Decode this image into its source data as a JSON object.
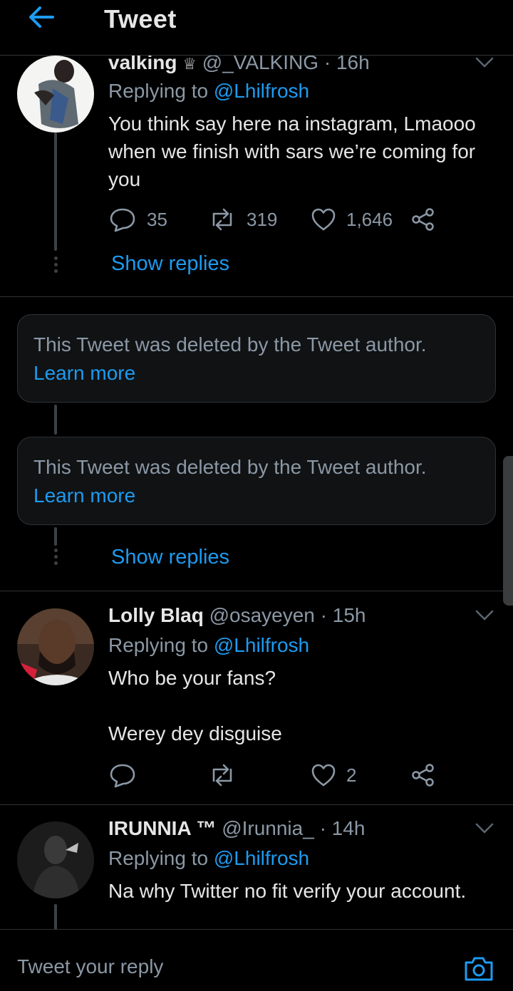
{
  "header": {
    "title": "Tweet"
  },
  "tweets": [
    {
      "name": "valking",
      "badge": "♕",
      "handle": "@_VALKING",
      "time": "· 16h",
      "replying_label": "Replying to",
      "replying_handle": "@Lhilfrosh",
      "text": "You think say here na instagram, Lmaooo when we finish with sars we’re coming for you",
      "replies": "35",
      "retweets": "319",
      "likes": "1,646"
    },
    {
      "name": "Lolly Blaq",
      "handle": "@osayeyen",
      "time": "· 15h",
      "replying_label": "Replying to",
      "replying_handle": "@Lhilfrosh",
      "text_line1": "Who be your fans?",
      "text_line2": "Werey dey disguise",
      "replies": "",
      "retweets": "",
      "likes": "2"
    },
    {
      "name": "IRUNNIA ™",
      "handle": "@Irunnia_",
      "time": "· 14h",
      "replying_label": "Replying to",
      "replying_handle": "@Lhilfrosh",
      "text": "Na why Twitter no fit verify your account."
    }
  ],
  "show_replies_label": "Show replies",
  "deleted": [
    {
      "text": "This Tweet was deleted by the Tweet author.",
      "link": "Learn more"
    },
    {
      "text": "This Tweet was deleted by the Tweet author.",
      "link": "Learn more"
    }
  ],
  "composer": {
    "placeholder": "Tweet your reply"
  },
  "colors": {
    "accent": "#1d9bf0",
    "background": "#000000",
    "muted": "#8b98a5",
    "text": "#e6e6e6"
  }
}
